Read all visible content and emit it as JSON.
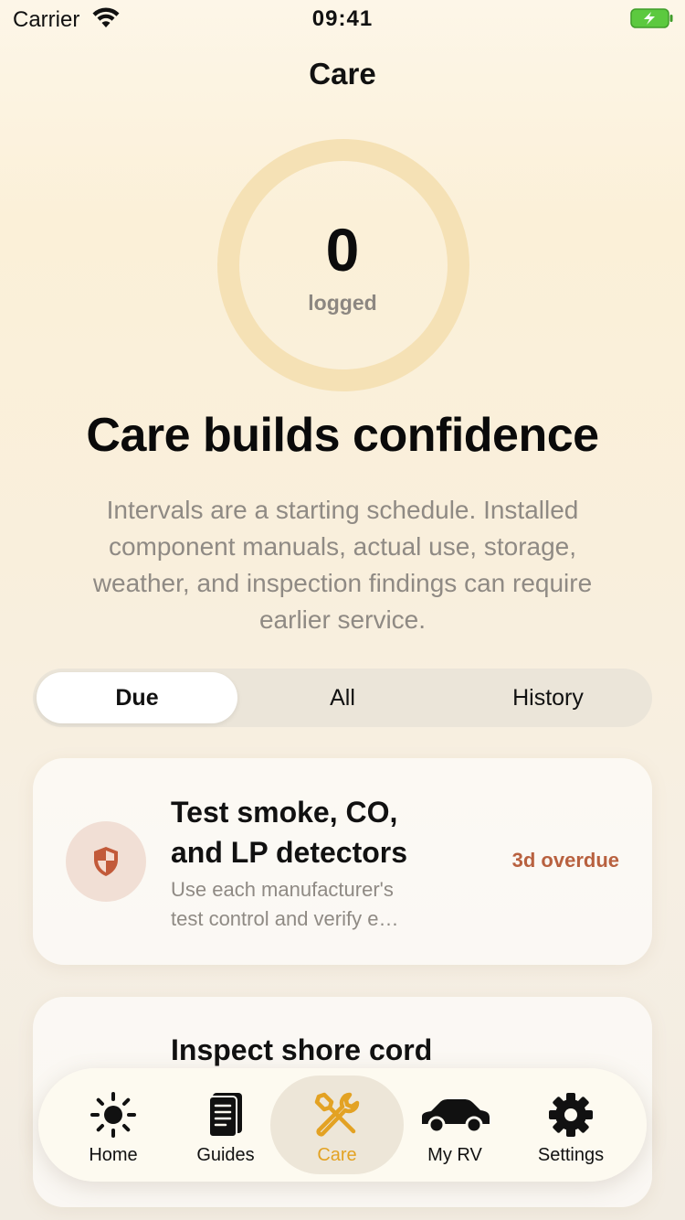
{
  "status_bar": {
    "carrier": "Carrier",
    "time": "09:41"
  },
  "nav": {
    "title": "Care"
  },
  "progress": {
    "count": "0",
    "label": "logged"
  },
  "headline": "Care builds confidence",
  "subtext_lines": [
    "Intervals are a starting schedule. Installed",
    "component manuals, actual use, storage,",
    "weather, and inspection findings can require",
    "earlier service."
  ],
  "segments": {
    "due": "Due",
    "all": "All",
    "history": "History",
    "selected": "Due"
  },
  "tasks": [
    {
      "title_lines": [
        "Test smoke, CO,",
        "and LP detectors"
      ],
      "desc_lines": [
        "Use each manufacturer's",
        "test control and verify e…"
      ],
      "status": "3d overdue",
      "icon": "shield-icon",
      "status_color": "#b8613f"
    },
    {
      "title": "Inspect shore cord"
    }
  ],
  "tabs": {
    "home": "Home",
    "guides": "Guides",
    "care": "Care",
    "my_rv": "My RV",
    "settings": "Settings",
    "active": "Care",
    "accent_color": "#e3a223"
  }
}
